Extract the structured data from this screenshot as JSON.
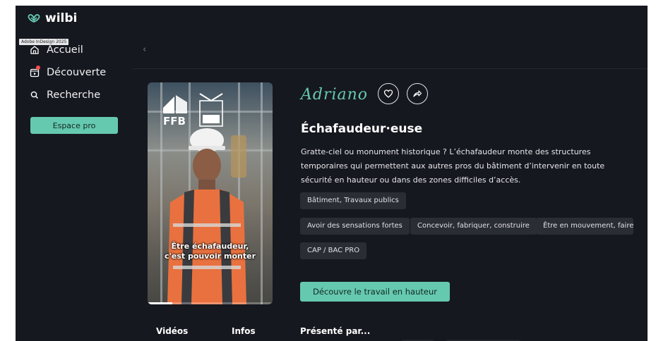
{
  "app": {
    "logo_text": "wilbi"
  },
  "tooltip": "Adobe InDesign 2025",
  "sidebar": {
    "items": [
      {
        "label": "Accueil",
        "icon": "home-icon"
      },
      {
        "label": "Découverte",
        "icon": "play-square-icon"
      },
      {
        "label": "Recherche",
        "icon": "search-icon"
      }
    ],
    "pro_button": "Espace pro"
  },
  "video": {
    "overlay_line1": "Être échafaudeur,",
    "overlay_line2": "c'est pouvoir monter",
    "progress": 0.2
  },
  "job": {
    "signature": "Adriano",
    "title": "Échafaudeur·euse",
    "description": "Gratte-ciel ou monument historique ? L’échafaudeur monte des structures temporaires qui permettent aux autres pros du bâtiment d’intervenir en toute sécurité en hauteur ou dans des zones difficiles d’accès.",
    "sector_tag": "Bâtiment, Travaux publics",
    "trait_tags": [
      "Avoir des sensations fortes",
      "Concevoir, fabriquer, construire",
      "Être en mouvement, faire c"
    ],
    "diploma_tag": "CAP / BAC PRO",
    "cta": "Découvre le travail en hauteur"
  },
  "tabs": {
    "videos": "Vidéos",
    "infos": "Infos",
    "presented": "Présenté par..."
  },
  "colors": {
    "background": "#16181f",
    "accent": "#65c9b0",
    "tag_bg": "#2b2d35",
    "notification": "#ff4d4d"
  }
}
